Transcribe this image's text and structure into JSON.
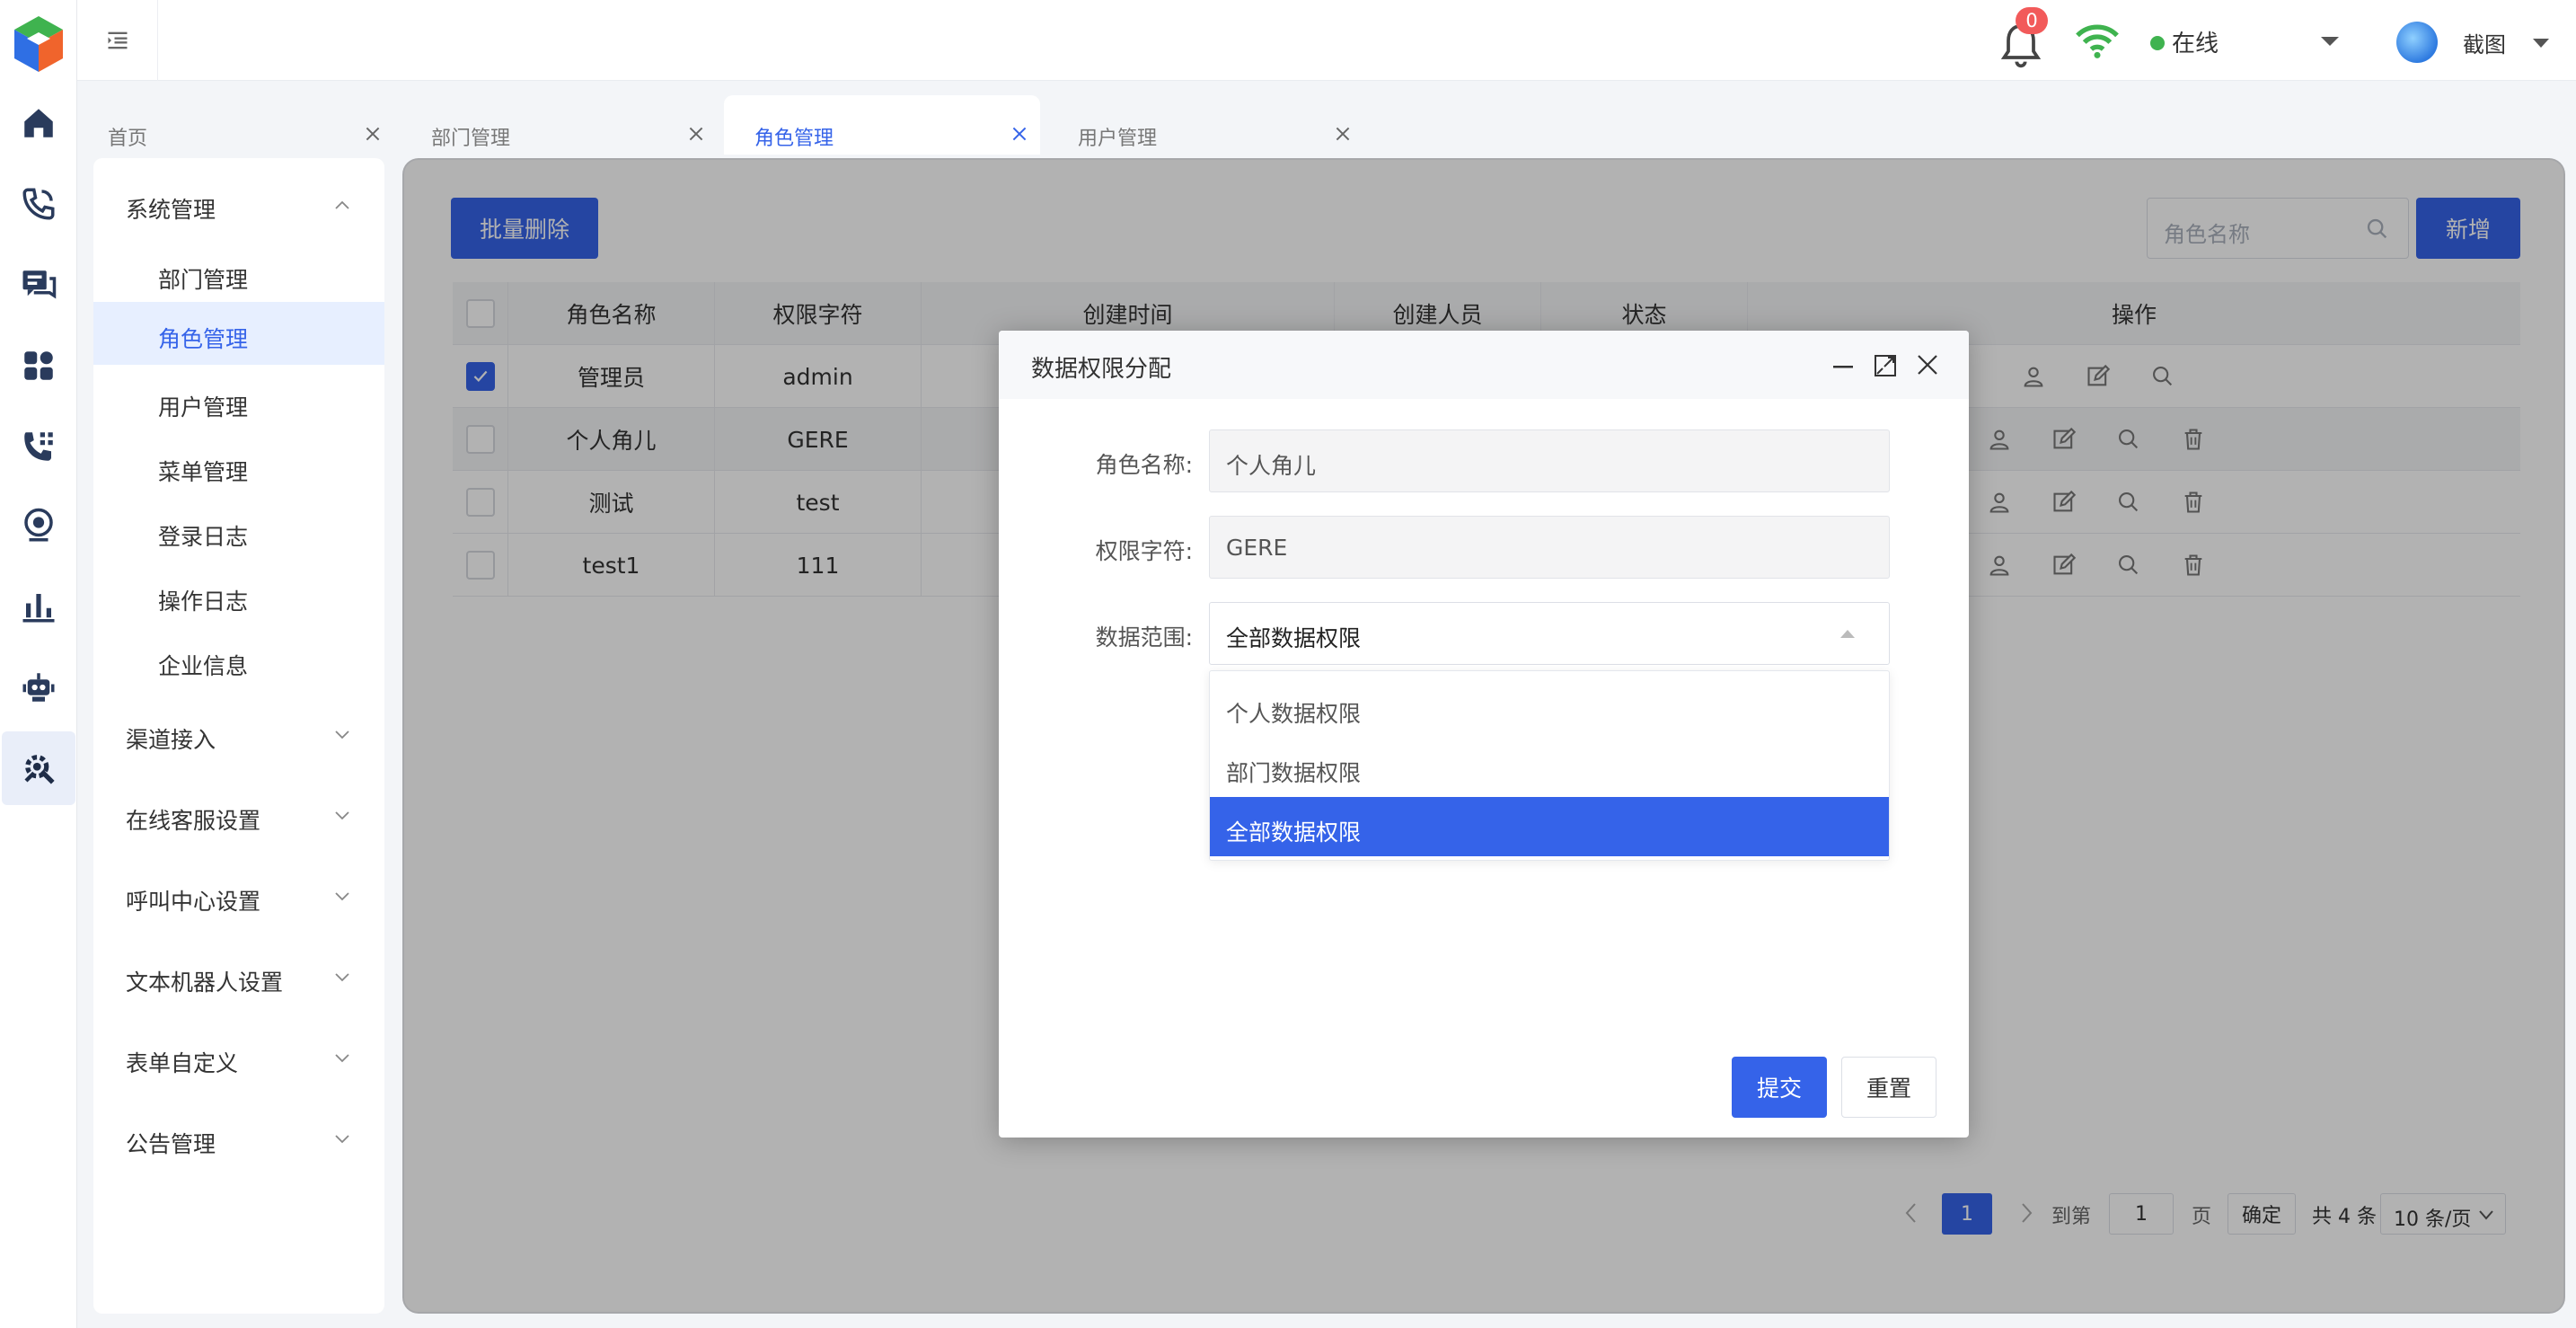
{
  "header": {
    "notification_count": "0",
    "status_text": "在线",
    "status_color": "#3fb34f",
    "user_name": "截图",
    "accent_color": "#3563e9"
  },
  "rail": {
    "icons": [
      "home-icon",
      "phone-call-icon",
      "chat-icon",
      "apps-icon",
      "phone-grid-icon",
      "webcam-icon",
      "bar-chart-icon",
      "robot-icon",
      "settings-tools-icon"
    ],
    "active_icon": "settings-tools-icon"
  },
  "tabs": [
    {
      "label": "首页",
      "active": false
    },
    {
      "label": "部门管理",
      "active": false
    },
    {
      "label": "角色管理",
      "active": true
    },
    {
      "label": "用户管理",
      "active": false
    }
  ],
  "sidebar": {
    "group_system": "系统管理",
    "system_items": [
      "部门管理",
      "角色管理",
      "用户管理",
      "菜单管理",
      "登录日志",
      "操作日志",
      "企业信息"
    ],
    "active_item": "角色管理",
    "groups": [
      "渠道接入",
      "在线客服设置",
      "呼叫中心设置",
      "文本机器人设置",
      "表单自定义",
      "公告管理"
    ]
  },
  "toolbar": {
    "batch_delete_label": "批量删除",
    "search_placeholder": "角色名称",
    "add_label": "新增"
  },
  "table": {
    "headers": [
      "角色名称",
      "权限字符",
      "创建时间",
      "创建人员",
      "状态",
      "操作"
    ],
    "rows": [
      {
        "checked": true,
        "name": "管理员",
        "key": "admin"
      },
      {
        "checked": false,
        "name": "个人角儿",
        "key": "GERE"
      },
      {
        "checked": false,
        "name": "测试",
        "key": "test"
      },
      {
        "checked": false,
        "name": "test1",
        "key": "111"
      }
    ]
  },
  "pagination": {
    "current_page": "1",
    "goto_label": "到第",
    "goto_value": "1",
    "page_label": "页",
    "confirm_label": "确定",
    "total_label": "共 4 条",
    "page_size_label": "10 条/页"
  },
  "dialog": {
    "title": "数据权限分配",
    "fields": {
      "role_name_label": "角色名称:",
      "role_name_value": "个人角儿",
      "perm_key_label": "权限字符:",
      "perm_key_value": "GERE",
      "scope_label": "数据范围:",
      "scope_value": "全部数据权限"
    },
    "scope_options": [
      "个人数据权限",
      "部门数据权限",
      "全部数据权限"
    ],
    "selected_option": "全部数据权限",
    "submit_label": "提交",
    "reset_label": "重置"
  }
}
